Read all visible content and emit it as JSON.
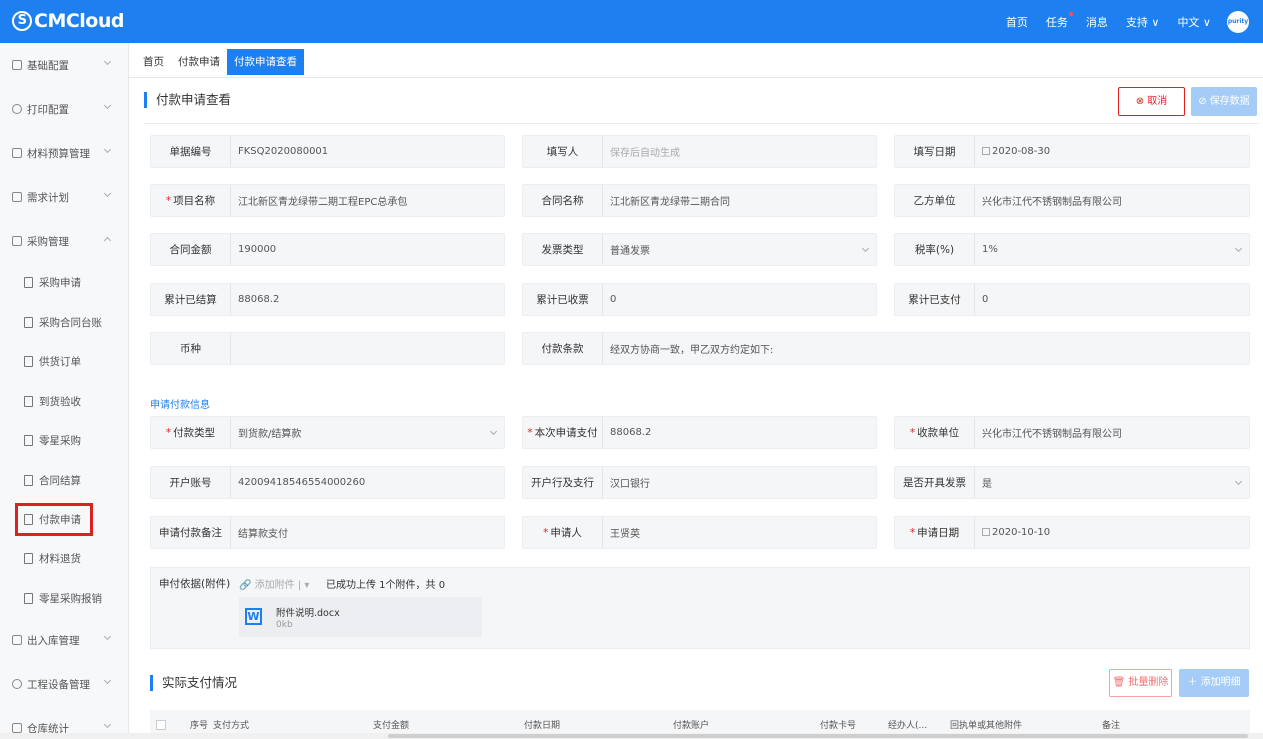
{
  "header": {
    "logo": "CMCloud",
    "nav": [
      "首页",
      "任务",
      "消息",
      "支持 ∨",
      "中文 ∨"
    ],
    "avatar_text": "purity"
  },
  "sidebar": {
    "items": [
      {
        "label": "基础配置",
        "icon": "grid-icon",
        "arrow": "down"
      },
      {
        "label": "打印配置",
        "icon": "gear-icon",
        "arrow": "down"
      },
      {
        "label": "材料预算管理",
        "icon": "doc-icon",
        "arrow": "down"
      },
      {
        "label": "需求计划",
        "icon": "plan-icon",
        "arrow": "down"
      },
      {
        "label": "采购管理",
        "icon": "org-icon",
        "arrow": "up"
      }
    ],
    "sub_items": [
      "采购申请",
      "采购合同台账",
      "供货订单",
      "到货验收",
      "零星采购",
      "合同结算",
      "付款申请",
      "材料退货",
      "零星采购报销"
    ],
    "bottom_items": [
      {
        "label": "出入库管理",
        "icon": "warehouse-icon"
      },
      {
        "label": "工程设备管理",
        "icon": "device-icon"
      },
      {
        "label": "仓库统计",
        "icon": "chart-icon"
      }
    ]
  },
  "tabs": [
    "首页",
    "付款申请",
    "付款申请查看"
  ],
  "page": {
    "title": "付款申请查看",
    "cancel_label": "⊗ 取消",
    "save_label": "⊘ 保存数据",
    "section_label": "申请付款信息",
    "actual_title": "实际支付情况",
    "batch_delete": "🗑 批量删除",
    "add_detail": "＋ 添加明细"
  },
  "fields": {
    "doc_no": {
      "label": "单据编号",
      "value": "FKSQ2020080001"
    },
    "filler": {
      "label": "填写人",
      "value": "保存后自动生成"
    },
    "fill_date": {
      "label": "填写日期",
      "value": "2020-08-30"
    },
    "project": {
      "label": "项目名称",
      "value": "江北新区青龙绿带二期工程EPC总承包"
    },
    "contract": {
      "label": "合同名称",
      "value": "江北新区青龙绿带二期合同"
    },
    "party_b": {
      "label": "乙方单位",
      "value": "兴化市江代不锈钢制品有限公司"
    },
    "amount": {
      "label": "合同金额",
      "value": "190000"
    },
    "invoice_type": {
      "label": "发票类型",
      "value": "普通发票"
    },
    "tax": {
      "label": "税率(%)",
      "value": "1%"
    },
    "settled": {
      "label": "累计已结算",
      "value": "88068.2"
    },
    "received": {
      "label": "累计已收票",
      "value": "0"
    },
    "paid": {
      "label": "累计已支付",
      "value": "0"
    },
    "currency": {
      "label": "币种",
      "value": ""
    },
    "terms": {
      "label": "付款条款",
      "value": "经双方协商一致，甲乙双方约定如下:"
    },
    "pay_type": {
      "label": "付款类型",
      "value": "到货款/结算款"
    },
    "this_pay": {
      "label": "本次申请支付",
      "value": "88068.2"
    },
    "payee": {
      "label": "收款单位",
      "value": "兴化市江代不锈钢制品有限公司"
    },
    "account": {
      "label": "开户账号",
      "value": "42009418546554000260"
    },
    "bank": {
      "label": "开户行及支行",
      "value": "汉口银行"
    },
    "invoice": {
      "label": "是否开具发票",
      "value": "是"
    },
    "remark": {
      "label": "申请付款备注",
      "value": "结算款支付"
    },
    "applicant": {
      "label": "申请人",
      "value": "王贤英"
    },
    "apply_date": {
      "label": "申请日期",
      "value": "2020-10-10"
    }
  },
  "attachment": {
    "label": "申付依据(附件)",
    "upload": "🔗 添加附件 | ▾",
    "info": "已成功上传 1个附件，共 0",
    "file_name": "附件说明.docx",
    "file_size": "0kb"
  },
  "table": {
    "columns": [
      "序号",
      "支付方式",
      "支付金额",
      "付款日期",
      "付款账户",
      "付款卡号",
      "经办人(...",
      "回执单或其他附件",
      "备注"
    ]
  }
}
